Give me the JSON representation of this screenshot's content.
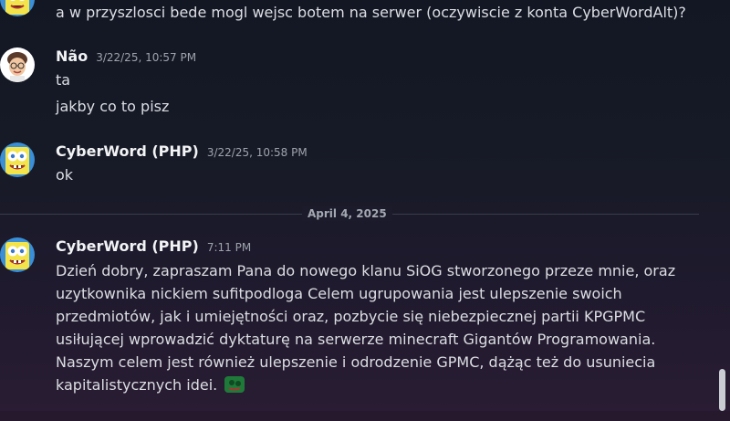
{
  "messages": {
    "continuation_text": "a w przyszlosci bede mogl wejsc botem na serwer (oczywiscie z konta CyberWordAlt)?",
    "nao": {
      "username": "Não",
      "timestamp": "3/22/25, 10:57 PM",
      "lines": [
        "ta",
        "jakby co to pisz"
      ]
    },
    "cyberword_1": {
      "username": "CyberWord (PHP)",
      "timestamp": "3/22/25, 10:58 PM",
      "lines": [
        "ok"
      ]
    },
    "date_divider": "April 4, 2025",
    "cyberword_2": {
      "username": "CyberWord (PHP)",
      "timestamp": "7:11 PM",
      "lines": [
        "Dzień dobry, zapraszam Pana do nowego klanu SiOG stworzonego przeze mnie, oraz",
        "uzytkownika nickiem sufitpodloga Celem ugrupowania jest ulepszenie swoich",
        "przedmiotów, jak i umiejętności oraz, pozbycie się niebezpiecznej partii KPGPMC",
        "usiłującej wprowadzić dyktaturę na serwerze minecraft Gigantów Programowania.",
        "Naszym celem jest również ulepszenie i odrodzenie GPMC, dążąc też do usuniecia",
        "kapitalistycznych idei."
      ],
      "emoji": "custom-emoji"
    }
  },
  "icons": {
    "avatar_nao": "memoji-avatar",
    "avatar_cyberword": "spongebob-avatar"
  },
  "colors": {
    "username": "#f2f3f5",
    "text": "#dcdee3",
    "timestamp": "#9ea3ad",
    "emoji_green": "#1f7a3a"
  }
}
